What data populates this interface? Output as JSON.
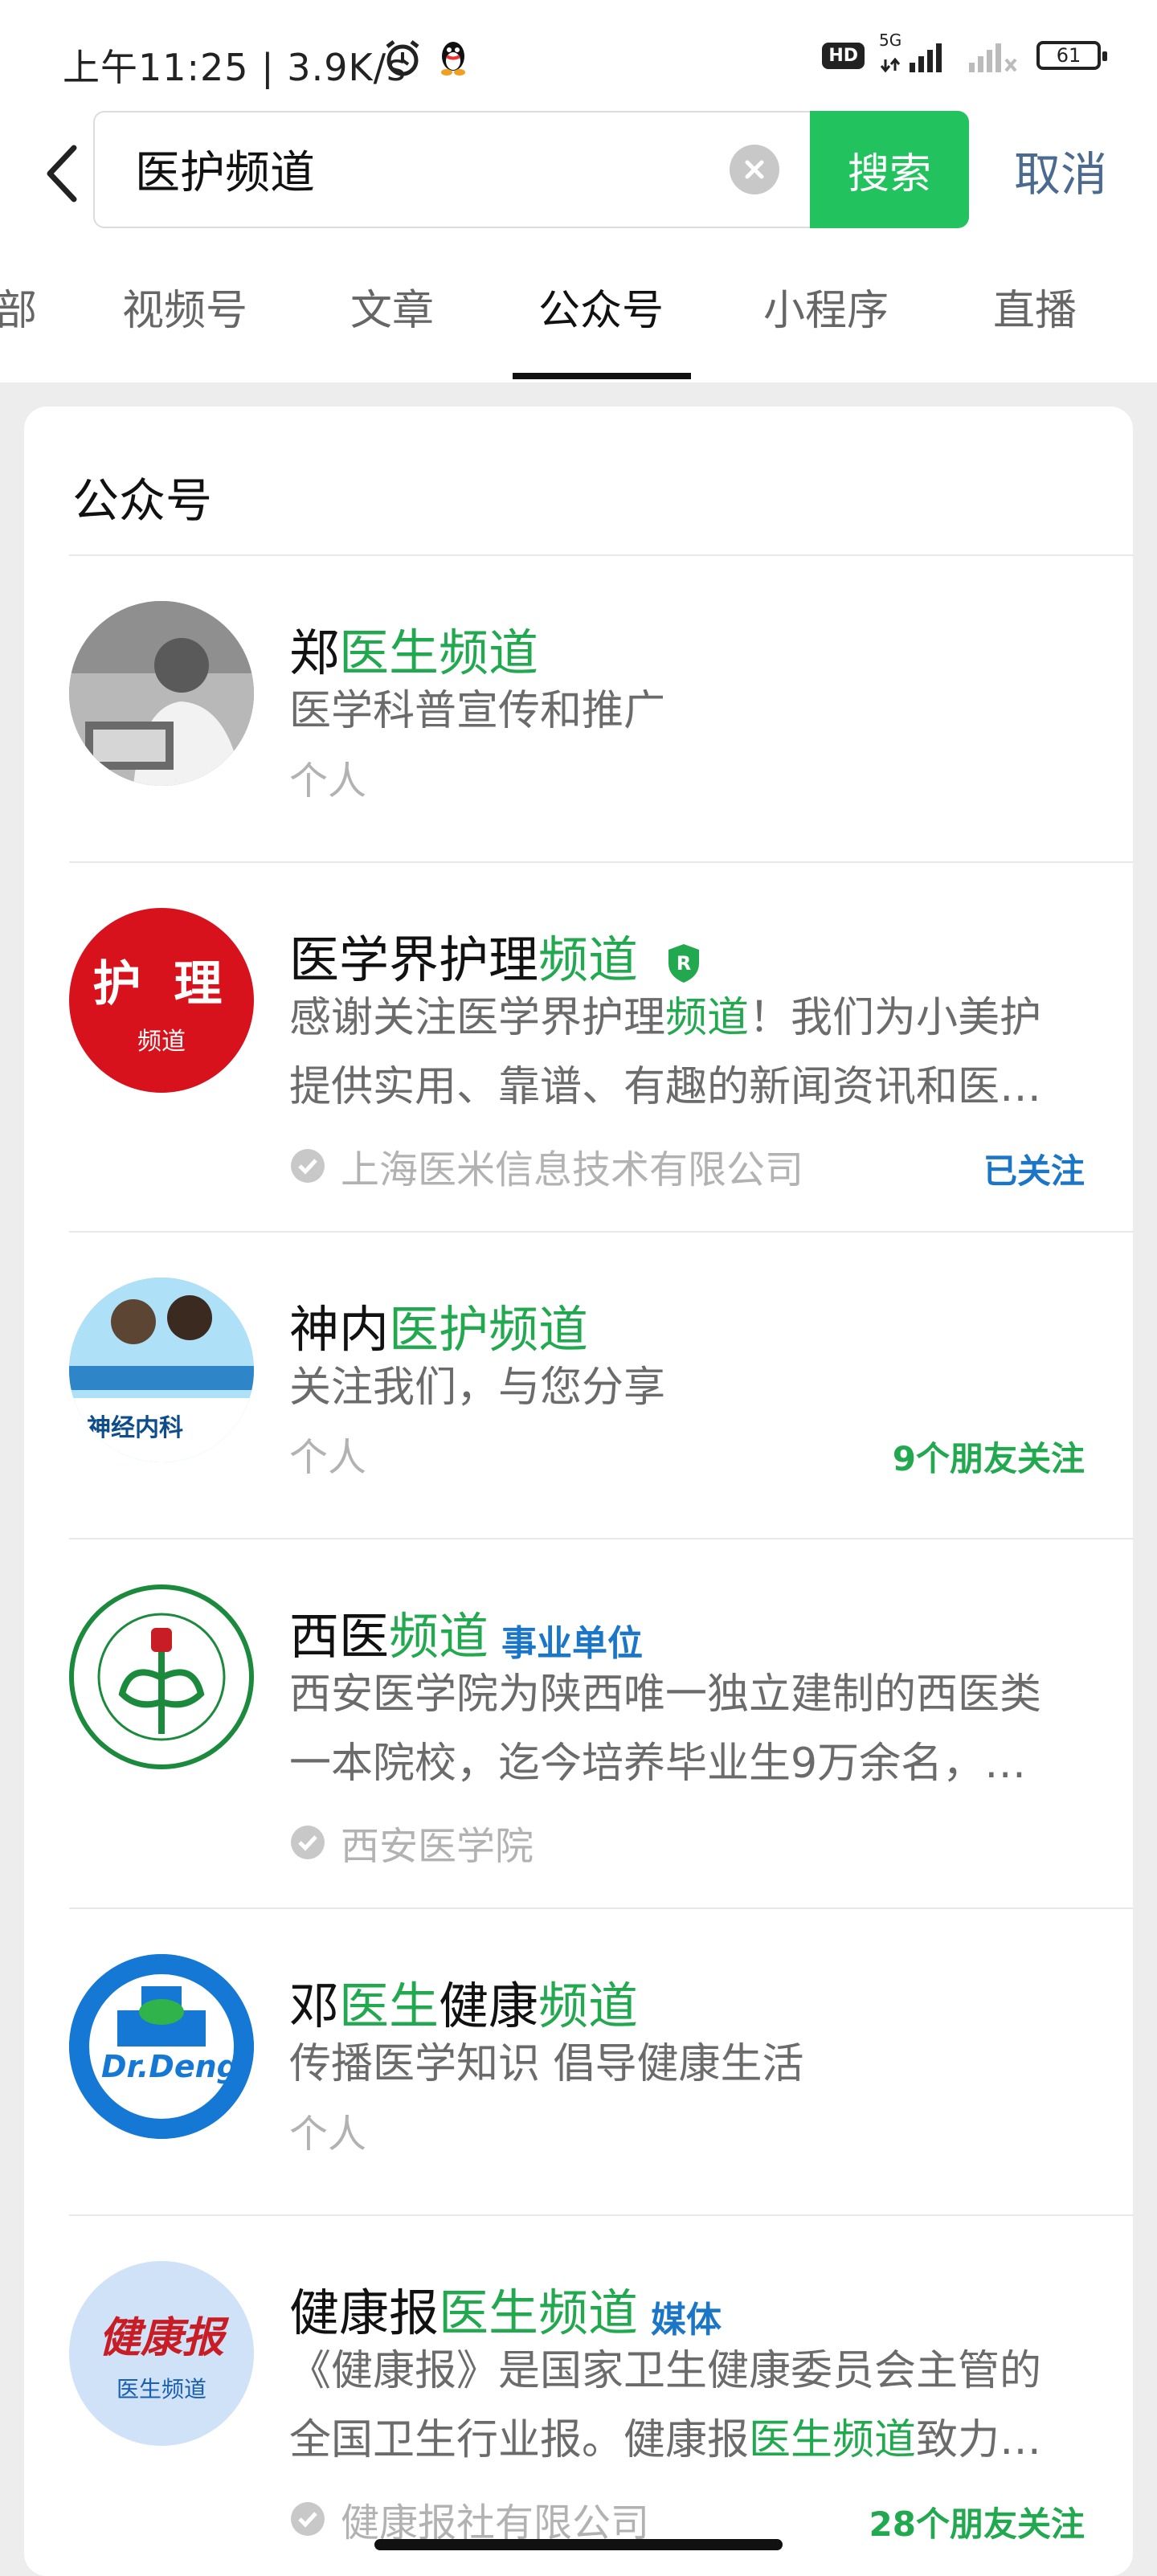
{
  "status_bar": {
    "time": "上午11:25 | 3.9K/s",
    "hd": "HD",
    "network": "5G",
    "battery": "61"
  },
  "search": {
    "query": "医护频道",
    "button": "搜索",
    "cancel": "取消"
  },
  "tabs": [
    "部",
    "视频号",
    "文章",
    "公众号",
    "小程序",
    "直播"
  ],
  "active_tab": "公众号",
  "section_title": "公众号",
  "results": [
    {
      "name_plain": "郑",
      "name_hl": "医生频道",
      "desc": "医学科普宣传和推广",
      "meta": "个人"
    },
    {
      "name_plain": "医学界护理",
      "name_hl": "频道",
      "desc_pre": "感谢关注医学界护理",
      "desc_hl": "频道",
      "desc_post": "！我们为小美护提供实用、靠谱、有趣的新闻资讯和医…",
      "meta": "上海医米信息技术有限公司",
      "right": "已关注",
      "avatar_text_1": "护 理",
      "avatar_text_2": "频道"
    },
    {
      "name_plain": "神内",
      "name_hl": "医护频道",
      "desc": "关注我们，与您分享",
      "meta": "个人",
      "right": "9个朋友关注",
      "avatar_text": "神经内科"
    },
    {
      "name_plain": "西医",
      "name_hl": "频道",
      "tag": "事业单位",
      "desc": "西安医学院为陕西唯一独立建制的西医类一本院校，迄今培养毕业生9万余名，…",
      "meta": "西安医学院"
    },
    {
      "name_plain_1": "邓",
      "name_hl_1": "医生",
      "name_plain_2": "健康",
      "name_hl_2": "频道",
      "desc": "传播医学知识 倡导健康生活",
      "meta": "个人",
      "avatar_text": "Dr.Deng"
    },
    {
      "name_plain": "健康报",
      "name_hl": "医生频道",
      "tag": "媒体",
      "desc_pre": "《健康报》是国家卫生健康委员会主管的全国卫生行业报。健康报",
      "desc_hl": "医生频道",
      "desc_post": "致力…",
      "meta": "健康报社有限公司",
      "right": "28个朋友关注",
      "avatar_text_1": "健康报",
      "avatar_text_2": "医生频道"
    }
  ]
}
